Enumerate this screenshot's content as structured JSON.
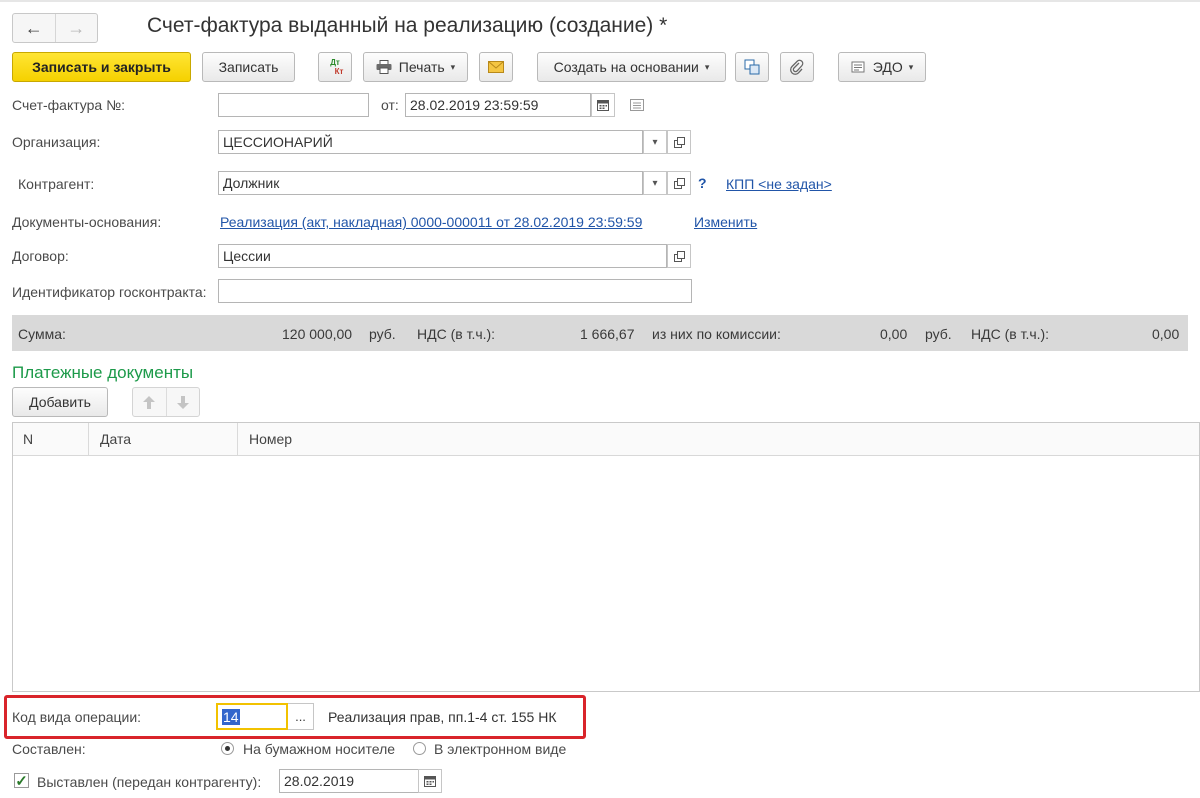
{
  "window": {
    "title": "Счет-фактура выданный на реализацию (создание) *"
  },
  "nav": {
    "back_icon": "←",
    "forward_icon": "→"
  },
  "toolbar": {
    "save_close": "Записать и закрыть",
    "save": "Записать",
    "dtkt_top": "Дт",
    "dtkt_bottom": "Кт",
    "print": "Печать",
    "create_based": "Создать на основании",
    "edo": "ЭДО",
    "dropdown_glyph": "▾"
  },
  "form": {
    "invoice_no_label": "Счет-фактура №:",
    "invoice_no_value": "",
    "date_label": "от:",
    "date_value": "28.02.2019 23:59:59",
    "org_label": "Организация:",
    "org_value": "ЦЕССИОНАРИЙ",
    "counterparty_label": "Контрагент:",
    "counterparty_value": "Должник",
    "help_mark": "?",
    "kpp_link": "КПП <не задан>",
    "base_docs_label": "Документы-основания:",
    "base_docs_link": "Реализация (акт, накладная) 0000-000011 от 28.02.2019 23:59:59",
    "change_link": "Изменить",
    "contract_label": "Договор:",
    "contract_value": "Цессии",
    "gov_contract_label": "Идентификатор госконтракта:",
    "gov_contract_value": ""
  },
  "summary": {
    "sum_label": "Сумма:",
    "sum_value": "120 000,00",
    "currency": "руб.",
    "vat_label": "НДС (в т.ч.):",
    "vat_value": "1 666,67",
    "commission_label": "из них по комиссии:",
    "commission_value": "0,00",
    "commission_currency": "руб.",
    "commission_vat_label": "НДС (в т.ч.):",
    "commission_vat_value": "0,00"
  },
  "payments": {
    "section_title": "Платежные документы",
    "add_button": "Добавить",
    "columns": [
      "N",
      "Дата",
      "Номер"
    ],
    "rows": []
  },
  "footer": {
    "op_code_label": "Код вида операции:",
    "op_code_value": "14",
    "op_code_button": "...",
    "op_code_desc": "Реализация прав, пп.1-4 ст. 155 НК",
    "composed_label": "Составлен:",
    "paper_option": "На бумажном носителе",
    "electronic_option": "В электронном виде",
    "issued_label": "Выставлен (передан контрагенту):",
    "issued_checked": true,
    "issued_date": "28.02.2019"
  },
  "colors": {
    "primary_button": "#f5d100",
    "link": "#2155a8",
    "section_title": "#1d9a4a",
    "highlight_border": "#d9242a",
    "summary_bar": "#d9d9d9"
  }
}
